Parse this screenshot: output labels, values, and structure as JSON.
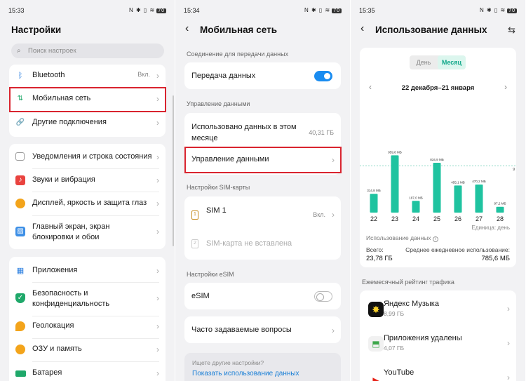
{
  "panel1": {
    "time": "15:33",
    "status_icons": "N ✱ ▯ ≋",
    "battery": "70",
    "title": "Настройки",
    "search_placeholder": "Поиск настроек",
    "group1": [
      {
        "label": "Bluetooth",
        "value": "Вкл.",
        "icon": "bluetooth-icon"
      },
      {
        "label": "Мобильная сеть",
        "icon": "mobile-network-icon"
      },
      {
        "label": "Другие подключения",
        "icon": "link-icon"
      }
    ],
    "group2": [
      {
        "label": "Уведомления и строка состояния",
        "icon": "notification-icon"
      },
      {
        "label": "Звуки и вибрация",
        "icon": "sound-icon"
      },
      {
        "label": "Дисплей, яркость и защита глаз",
        "icon": "display-icon"
      },
      {
        "label1": "Главный экран, экран",
        "label2": "блокировки и обои",
        "icon": "wallpaper-icon"
      }
    ],
    "group3": [
      {
        "label": "Приложения",
        "icon": "apps-icon"
      },
      {
        "label1": "Безопасность и",
        "label2": "конфиденциальность",
        "icon": "shield-icon"
      },
      {
        "label": "Геолокация",
        "icon": "location-icon"
      },
      {
        "label": "ОЗУ и память",
        "icon": "memory-icon"
      },
      {
        "label": "Батарея",
        "icon": "battery-icon"
      }
    ]
  },
  "panel2": {
    "time": "15:34",
    "status_icons": "N ✱ ▯ ≋",
    "battery": "70",
    "title": "Мобильная сеть",
    "section_connection": "Соединение для передачи данных",
    "data_transfer": "Передача данных",
    "data_transfer_on": true,
    "section_data_mgmt": "Управление данными",
    "used_line1": "Использовано данных в этом",
    "used_line2": "месяце",
    "used_value": "40,31 ГБ",
    "manage_data": "Управление данными",
    "section_sim": "Настройки SIM-карты",
    "sim1_label": "SIM 1",
    "sim1_value": "Вкл.",
    "sim2_label": "SIM-карта не вставлена",
    "sim1_number": "1",
    "sim2_number": "2",
    "section_esim": "Настройки eSIM",
    "esim_label": "eSIM",
    "esim_on": false,
    "faq_label": "Часто задаваемые вопросы",
    "looking_for": "Ищете другие настройки?",
    "show_usage_link": "Показать использование данных"
  },
  "panel3": {
    "time": "15:35",
    "status_icons": "N ✱ ▯ ≋",
    "battery": "70",
    "title": "Использование данных",
    "tab_day": "День",
    "tab_month": "Месяц",
    "period": "22 декабря–21 января",
    "unit_note": "Единица: день",
    "usage_label": "Использование данных",
    "total_label": "Всего:",
    "total_value": "23,78 ГБ",
    "avg_label": "Среднее ежедневное использование:",
    "avg_value": "785,6 МБ",
    "rating_title": "Ежемесячный рейтинг трафика",
    "apps": [
      {
        "name": "Яндекс Музыка",
        "size": "8,99 ГБ",
        "icon": "yandex-music-icon"
      },
      {
        "name": "Приложения удалены",
        "size": "4,07 ГБ",
        "icon": "android-icon"
      },
      {
        "name": "YouTube",
        "size": "",
        "icon": "youtube-icon"
      }
    ]
  },
  "chart_data": {
    "type": "bar",
    "categories": [
      "22",
      "23",
      "24",
      "25",
      "26",
      "27",
      "28"
    ],
    "values": [
      314.8,
      959.8,
      197,
      834.9,
      455.1,
      470.2,
      97.2
    ],
    "data_labels": [
      "314,8 МБ",
      "959,8 МБ",
      "197,0 МБ",
      "834,9 МБ",
      "455,1 МБ",
      "470,2 МБ",
      "97,2 МБ"
    ],
    "ylim": [
      0,
      1000
    ],
    "reference_line": 785.6,
    "color": "#1fc3a0",
    "grid": false,
    "truncated_label": "9"
  }
}
